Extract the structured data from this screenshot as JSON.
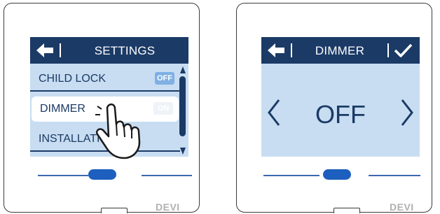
{
  "colors": {
    "header_bg": "#1b3a66",
    "screen_bg": "#c8ddf1",
    "accent_blue": "#1d5fbe",
    "toggle_off": "#7fb0e4",
    "brand_gray": "#b0b0b0"
  },
  "left_panel": {
    "header": {
      "back_icon": "back-arrow-icon",
      "title": "SETTINGS"
    },
    "menu": [
      {
        "label": "CHILD LOCK",
        "toggle": "OFF",
        "selected": false
      },
      {
        "label": "DIMMER",
        "toggle": "ON",
        "selected": true
      },
      {
        "label": "INSTALLATION",
        "toggle": "",
        "selected": false
      }
    ],
    "brand": "DEVI"
  },
  "right_panel": {
    "header": {
      "back_icon": "back-arrow-icon",
      "title": "DIMMER",
      "confirm_icon": "checkmark-icon"
    },
    "value": "OFF",
    "prev_icon": "chevron-left-icon",
    "next_icon": "chevron-right-icon",
    "brand": "DEVI"
  }
}
